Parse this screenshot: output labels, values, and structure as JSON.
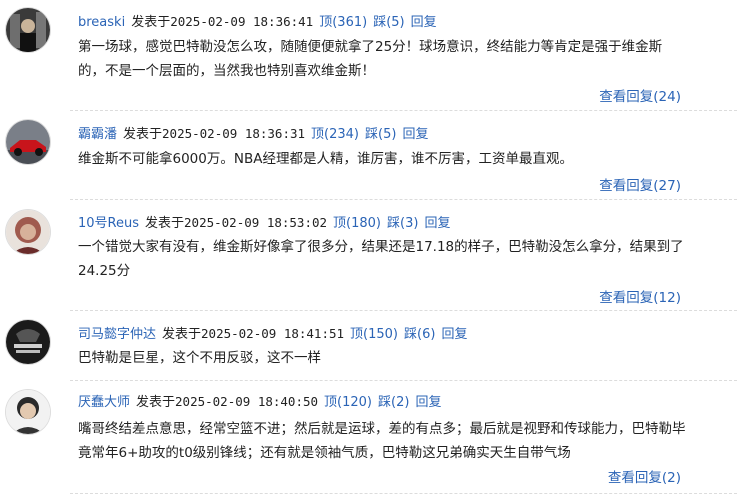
{
  "labels": {
    "posted_at": "发表于",
    "up": "顶",
    "down": "踩",
    "reply": "回复",
    "view_replies": "查看回复"
  },
  "comments": [
    {
      "user": "breaski",
      "time": "2025-02-09 18:36:41",
      "up": "(361)",
      "down": "(5)",
      "text": "第一场球，感觉巴特勒没怎么攻，随随便便就拿了25分！球场意识，终结能力等肯定是强于维金斯的，不是一个层面的，当然我也特别喜欢维金斯！",
      "replies": "(24)"
    },
    {
      "user": "霸霸潘",
      "time": "2025-02-09 18:36:31",
      "up": "(234)",
      "down": "(5)",
      "text": "维金斯不可能拿6000万。NBA经理都是人精，谁厉害，谁不厉害，工资单最直观。",
      "replies": "(27)"
    },
    {
      "user": "10号Reus",
      "time": "2025-02-09 18:53:02",
      "up": "(180)",
      "down": "(3)",
      "text": "一个错觉大家有没有，维金斯好像拿了很多分，结果还是17.18的样子，巴特勒没怎么拿分，结果到了24.25分",
      "replies": "(12)"
    },
    {
      "user": "司马懿字仲达",
      "time": "2025-02-09 18:41:51",
      "up": "(150)",
      "down": "(6)",
      "text": "巴特勒是巨星，这个不用反驳，这不一样",
      "replies": ""
    },
    {
      "user": "厌蠢大师",
      "time": "2025-02-09 18:40:50",
      "up": "(120)",
      "down": "(2)",
      "text": "嘴哥终结差点意思，经常空篮不进；然后就是运球，差的有点多；最后就是视野和传球能力，巴特勒毕竟常年6+助攻的t0级别锋线；还有就是领袖气质，巴特勒这兄弟确实天生自带气场",
      "replies": "(2)"
    }
  ]
}
